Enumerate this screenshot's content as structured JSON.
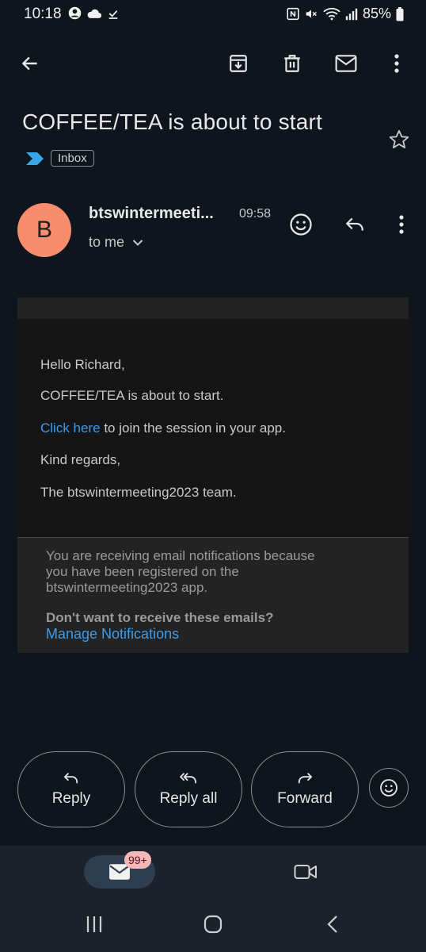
{
  "status_bar": {
    "time": "10:18",
    "battery": "85%",
    "left_icons": [
      "account-circle-icon",
      "cloud-icon",
      "download-done-icon"
    ],
    "right_icons": [
      "nfc-icon",
      "mute-icon",
      "wifi-icon",
      "signal-icon",
      "battery-icon"
    ]
  },
  "appbar": {
    "icons": [
      "back-arrow-icon",
      "archive-icon",
      "delete-icon",
      "mark-unread-icon",
      "more-vert-icon"
    ]
  },
  "email": {
    "subject": "COFFEE/TEA is about to start",
    "label": "Inbox",
    "avatar_letter": "B",
    "sender": "btswintermeeti...",
    "time": "09:58",
    "recipient": "to me",
    "body": {
      "greeting": "Hello Richard,",
      "line1": "COFFEE/TEA is about to start.",
      "link_text": "Click here",
      "link_suffix": " to join the session in your app.",
      "closing": "Kind regards,",
      "signature": "The btswintermeeting2023 team."
    },
    "footer": {
      "line1": "You are receiving email notifications because",
      "line2": "you have been registered on the",
      "line3": "btswintermeeting2023 app.",
      "question": "Don't want to receive these emails?",
      "manage_link": "Manage Notifications"
    }
  },
  "actions": {
    "reply": "Reply",
    "reply_all": "Reply all",
    "forward": "Forward"
  },
  "bottom_nav": {
    "mail_badge": "99+"
  },
  "colors": {
    "background": "#0f151c",
    "avatar": "#f78d6d",
    "link": "#3d9be9",
    "label_arrow": "#3ba7e8"
  }
}
